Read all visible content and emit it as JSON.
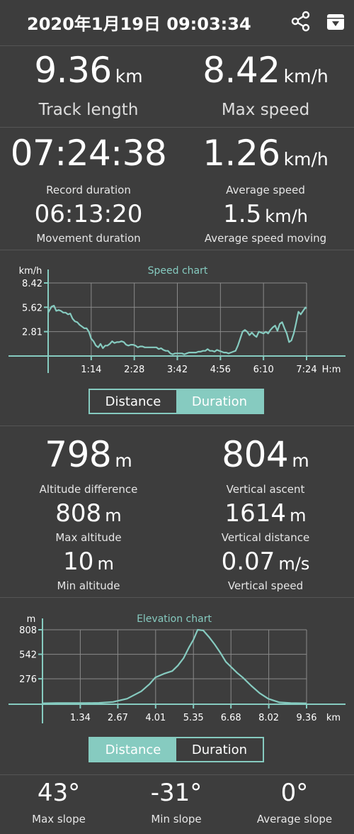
{
  "header": {
    "title": "2020年1月19日 09:03:34",
    "share_icon": "share-icon",
    "save_icon": "download-icon"
  },
  "summary": {
    "track_length": {
      "value": "9.36",
      "unit": "km",
      "label": "Track length"
    },
    "max_speed": {
      "value": "8.42",
      "unit": "km/h",
      "label": "Max speed"
    }
  },
  "times": {
    "record_duration": {
      "value": "07:24:38",
      "label": "Record duration"
    },
    "average_speed": {
      "value": "1.26",
      "unit": "km/h",
      "label": "Average speed"
    },
    "movement_duration": {
      "value": "06:13:20",
      "label": "Movement duration"
    },
    "average_speed_moving": {
      "value": "1.5",
      "unit": "km/h",
      "label": "Average speed moving"
    }
  },
  "speed_toggle": {
    "left": "Distance",
    "right": "Duration",
    "selected": "Duration"
  },
  "altitude": {
    "difference": {
      "value": "798",
      "unit": "m",
      "label": "Altitude difference"
    },
    "vertical_ascent": {
      "value": "804",
      "unit": "m",
      "label": "Vertical ascent"
    },
    "max": {
      "value": "808",
      "unit": "m",
      "label": "Max altitude"
    },
    "vertical_distance": {
      "value": "1614",
      "unit": "m",
      "label": "Vertical distance"
    },
    "min": {
      "value": "10",
      "unit": "m",
      "label": "Min altitude"
    },
    "vertical_speed": {
      "value": "0.07",
      "unit": "m/s",
      "label": "Vertical speed"
    }
  },
  "elevation_toggle": {
    "left": "Distance",
    "right": "Duration",
    "selected": "Distance"
  },
  "slopes": {
    "max": {
      "value": "43°",
      "label": "Max slope"
    },
    "min": {
      "value": "-31°",
      "label": "Min slope"
    },
    "avg": {
      "value": "0°",
      "label": "Average slope"
    }
  },
  "colors": {
    "accent": "#86cbc0",
    "background": "#3d3d3d"
  },
  "chart_data": [
    {
      "type": "line",
      "title": "Speed chart",
      "ylabel": "km/h",
      "xlabel": "H:m",
      "yticks": [
        "8.42",
        "5.62",
        "2.81"
      ],
      "xticks": [
        "1:14",
        "2:28",
        "3:42",
        "4:56",
        "6:10",
        "7:24"
      ],
      "ylim": [
        0,
        8.42
      ],
      "xlim_minutes": [
        0,
        444
      ],
      "grid": true,
      "series": [
        {
          "x": [
            0,
            6,
            10,
            14,
            18,
            22,
            26,
            30,
            34,
            38,
            42,
            46,
            50,
            54,
            58,
            62,
            66,
            70,
            74,
            78,
            82,
            86,
            90,
            94,
            98,
            102,
            106,
            110,
            114,
            118,
            122,
            126,
            130,
            134,
            138,
            142,
            146,
            150,
            154,
            158,
            162,
            166,
            170,
            174,
            178,
            182,
            186,
            190,
            194,
            198,
            202,
            206,
            210,
            214,
            218,
            222,
            226,
            230,
            234,
            238,
            242,
            246,
            250,
            254,
            258,
            262,
            266,
            270,
            274,
            278,
            282,
            286,
            290,
            294,
            298,
            302,
            306,
            310,
            314,
            318,
            322,
            326,
            330,
            334,
            338,
            342,
            346,
            350,
            354,
            358,
            362,
            366,
            370,
            374,
            378,
            382,
            386,
            390,
            394,
            398,
            402,
            406,
            410,
            414,
            418,
            422,
            426,
            430,
            434,
            438,
            442,
            444
          ],
          "values": [
            5.0,
            5.7,
            5.8,
            5.2,
            5.3,
            5.2,
            5.0,
            5.0,
            4.8,
            4.9,
            4.3,
            4.0,
            3.9,
            3.6,
            3.4,
            3.2,
            3.2,
            2.8,
            2.0,
            1.7,
            1.2,
            1.0,
            1.4,
            0.9,
            1.2,
            1.2,
            1.4,
            1.7,
            1.5,
            1.6,
            1.6,
            1.7,
            1.6,
            1.3,
            1.2,
            1.3,
            1.3,
            1.2,
            1.0,
            1.1,
            1.1,
            1.0,
            1.0,
            1.0,
            1.0,
            1.0,
            1.0,
            0.8,
            0.9,
            0.7,
            0.6,
            0.6,
            0.3,
            0.2,
            0.3,
            0.3,
            0.3,
            0.3,
            0.2,
            0.3,
            0.4,
            0.4,
            0.4,
            0.4,
            0.5,
            0.5,
            0.6,
            0.6,
            0.8,
            0.6,
            0.6,
            0.5,
            0.7,
            0.6,
            0.5,
            0.4,
            0.4,
            0.3,
            0.4,
            0.5,
            0.6,
            1.2,
            2.0,
            2.8,
            3.0,
            2.8,
            2.4,
            2.7,
            2.4,
            2.2,
            2.8,
            2.7,
            2.6,
            2.8,
            2.6,
            3.0,
            3.3,
            3.5,
            2.9,
            3.7,
            3.9,
            3.2,
            2.6,
            1.6,
            1.8,
            2.6,
            3.8,
            5.1,
            4.8,
            5.2,
            5.6,
            5.5
          ]
        }
      ]
    },
    {
      "type": "area",
      "title": "Elevation chart",
      "ylabel": "m",
      "xlabel": "km",
      "yticks": [
        "808",
        "542",
        "276"
      ],
      "xticks": [
        "1.34",
        "2.67",
        "4.01",
        "5.35",
        "6.68",
        "8.02",
        "9.36"
      ],
      "ylim": [
        0,
        808
      ],
      "xlim": [
        0,
        9.36
      ],
      "grid": true,
      "series": [
        {
          "x": [
            0,
            0.5,
            1.0,
            1.5,
            2.0,
            2.5,
            3.0,
            3.5,
            3.8,
            4.0,
            4.3,
            4.6,
            4.8,
            5.0,
            5.2,
            5.35,
            5.5,
            5.7,
            5.9,
            6.1,
            6.3,
            6.5,
            6.7,
            6.9,
            7.1,
            7.4,
            7.7,
            8.0,
            8.4,
            8.8,
            9.36
          ],
          "values": [
            10,
            12,
            12,
            12,
            15,
            25,
            60,
            140,
            220,
            290,
            330,
            360,
            420,
            500,
            620,
            700,
            808,
            800,
            730,
            650,
            560,
            460,
            400,
            340,
            290,
            200,
            120,
            60,
            20,
            12,
            10
          ]
        }
      ]
    }
  ]
}
